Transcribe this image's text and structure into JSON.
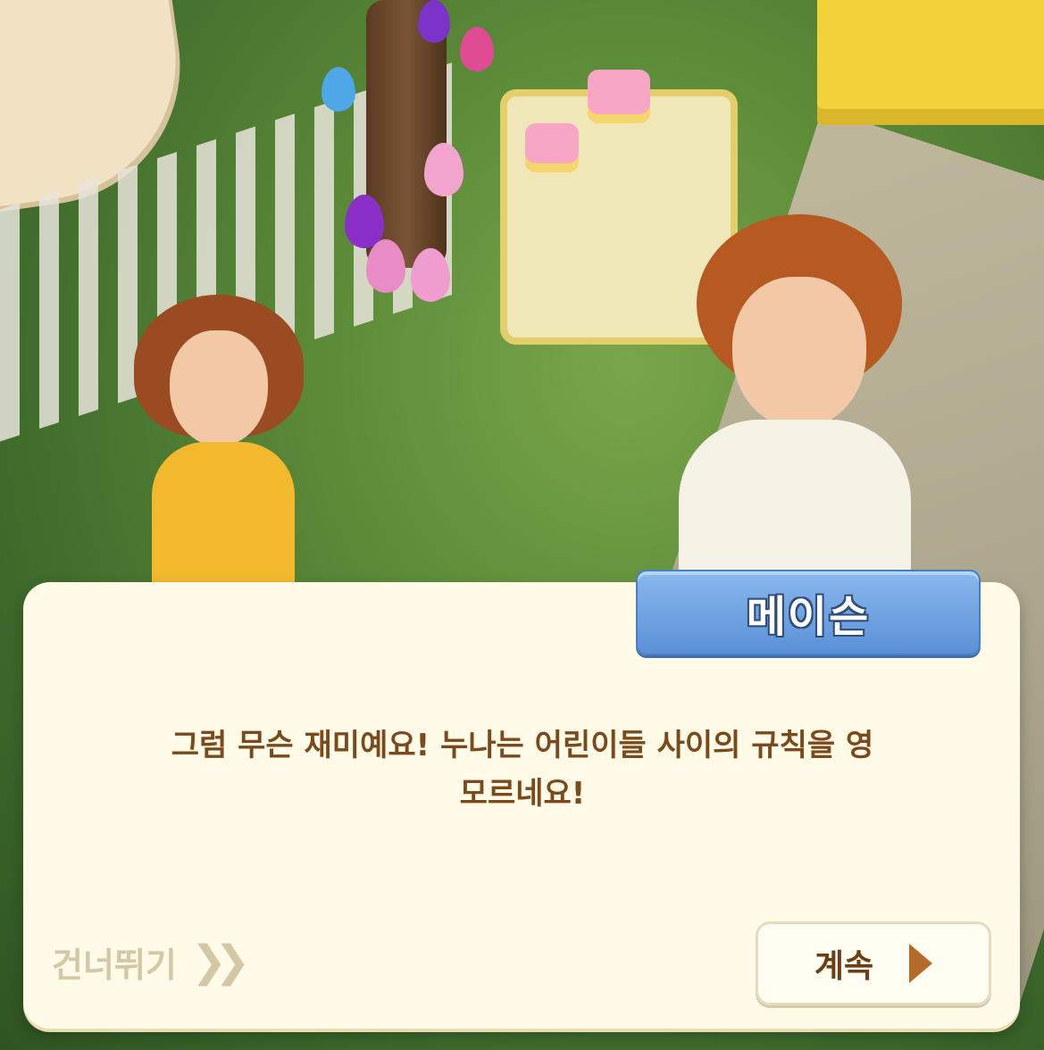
{
  "dialog": {
    "speaker": "메이슨",
    "line1": "그럼 무슨 재미예요! 누나는 어린이들 사이의 규칙을 영",
    "line2": "모르네요!"
  },
  "controls": {
    "skip_label": "건너뛰기",
    "skip_icon": "double-chevron-right-icon",
    "continue_label": "계속",
    "continue_icon": "play-triangle-icon"
  },
  "colors": {
    "dialog_background": "#fffbe6",
    "speaker_tag": "#6a9fe0",
    "dialog_text": "#7a4a1e",
    "skip_text": "#d4c7a6",
    "continue_arrow": "#b66a2a"
  }
}
